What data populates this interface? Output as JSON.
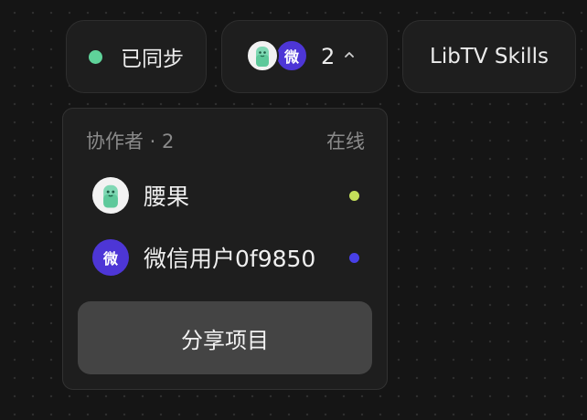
{
  "sync": {
    "label": "已同步",
    "color": "#5fd39a"
  },
  "collaborators_button": {
    "count": "2",
    "avatar_text": "微"
  },
  "skills_button": {
    "label": "LibTV Skills"
  },
  "dropdown": {
    "title": "协作者 · 2",
    "online_label": "在线",
    "members": [
      {
        "name": "腰果",
        "avatar": "robot-avatar",
        "status_color": "#c4e05a"
      },
      {
        "name": "微信用户0f9850",
        "avatar_text": "微",
        "status_color": "#4840e8"
      }
    ],
    "share_label": "分享项目"
  }
}
